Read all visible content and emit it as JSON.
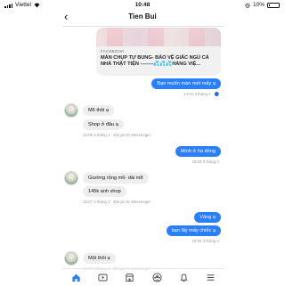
{
  "status": {
    "carrier": "Viettel",
    "time": "10:48",
    "battery": "10%",
    "battery_level": 0.1
  },
  "header": {
    "back_icon": "chevron-left-icon",
    "title": "Tien Bui"
  },
  "shared_link": {
    "source": "FACEBOOK",
    "title": "MÀN CHỤP TỰ BUNG- BẢO VỆ GIẤC NGỦ CẢ NHÀ THẬT TIỆN --------💦💦💦HÀNG VIỆ..."
  },
  "messages": [
    {
      "id": "m1",
      "from": "me",
      "text": "Bạn muốn màn mét mấy ạ"
    },
    {
      "id": "m2",
      "from": "them",
      "text": "M6 thôi ạ"
    },
    {
      "id": "m3",
      "from": "them",
      "text": "Shop ở đâu ạ"
    },
    {
      "id": "m4",
      "from": "me",
      "text": "Mình ở hà đông"
    },
    {
      "id": "m5",
      "from": "them",
      "text": "Giường rộng m6- dài m8"
    },
    {
      "id": "m6",
      "from": "them",
      "text": "145k anh shop"
    },
    {
      "id": "m7",
      "from": "me",
      "text": "Vâng ạ"
    },
    {
      "id": "m8",
      "from": "me",
      "text": "bạn lấy mấy chiếc ạ"
    },
    {
      "id": "m9",
      "from": "them",
      "text": "Một thôi ạ"
    }
  ],
  "meta": {
    "t1": "14:04 3 tháng 2 · 🔵",
    "t2": "15:05 3 tháng 2 · Đã gửi từ Messenger",
    "t3": "15:06 3 tháng 2",
    "t4": "15:07 3 tháng 2 · Đã gửi từ Messenger",
    "t5": "15:06 3 tháng 2",
    "t6": "15:07 3 tháng 2 · Đã gửi từ Messenger"
  },
  "tabbar": {
    "items": [
      {
        "name": "home-icon",
        "active": true
      },
      {
        "name": "watch-icon",
        "active": false
      },
      {
        "name": "marketplace-icon",
        "active": false
      },
      {
        "name": "groups-icon",
        "active": false
      },
      {
        "name": "bell-icon",
        "active": false
      },
      {
        "name": "menu-icon",
        "active": false
      }
    ]
  },
  "colors": {
    "accent": "#2a7fff",
    "incoming_bubble": "#eeeeee"
  }
}
